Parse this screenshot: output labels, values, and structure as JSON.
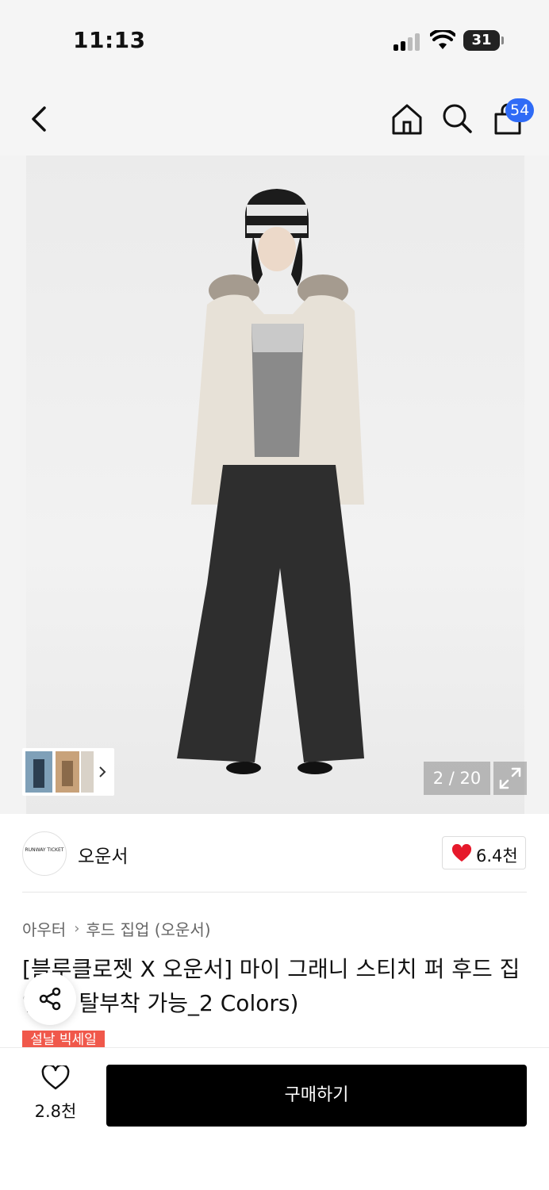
{
  "status_bar": {
    "time": "11:13",
    "battery": "31"
  },
  "nav": {
    "back_icon": "chevron-left-icon",
    "home_icon": "home-icon",
    "search_icon": "search-icon",
    "cart_icon": "shopping-bag-icon",
    "cart_badge": "54",
    "badge_color": "#2f6bf6"
  },
  "gallery": {
    "counter": "2 / 20",
    "expand_icon": "expand-icon"
  },
  "brand": {
    "logo_text": "RUNWAY TICKET",
    "name": "오운서",
    "likes": "6.4천",
    "heart_color": "#e6192b"
  },
  "product": {
    "breadcrumb": [
      "아우터",
      "후드 집업 (오운서)"
    ],
    "title": "[블루클로젯 X 오운서] 마이 그래니 스티치 퍼 후드 집업(퍼 탈부착 가능_2 Colors)",
    "sale_tag": "설날 빅세일",
    "sale_color": "#f0584b"
  },
  "bottom": {
    "wish_count": "2.8천",
    "buy_label": "구매하기"
  }
}
